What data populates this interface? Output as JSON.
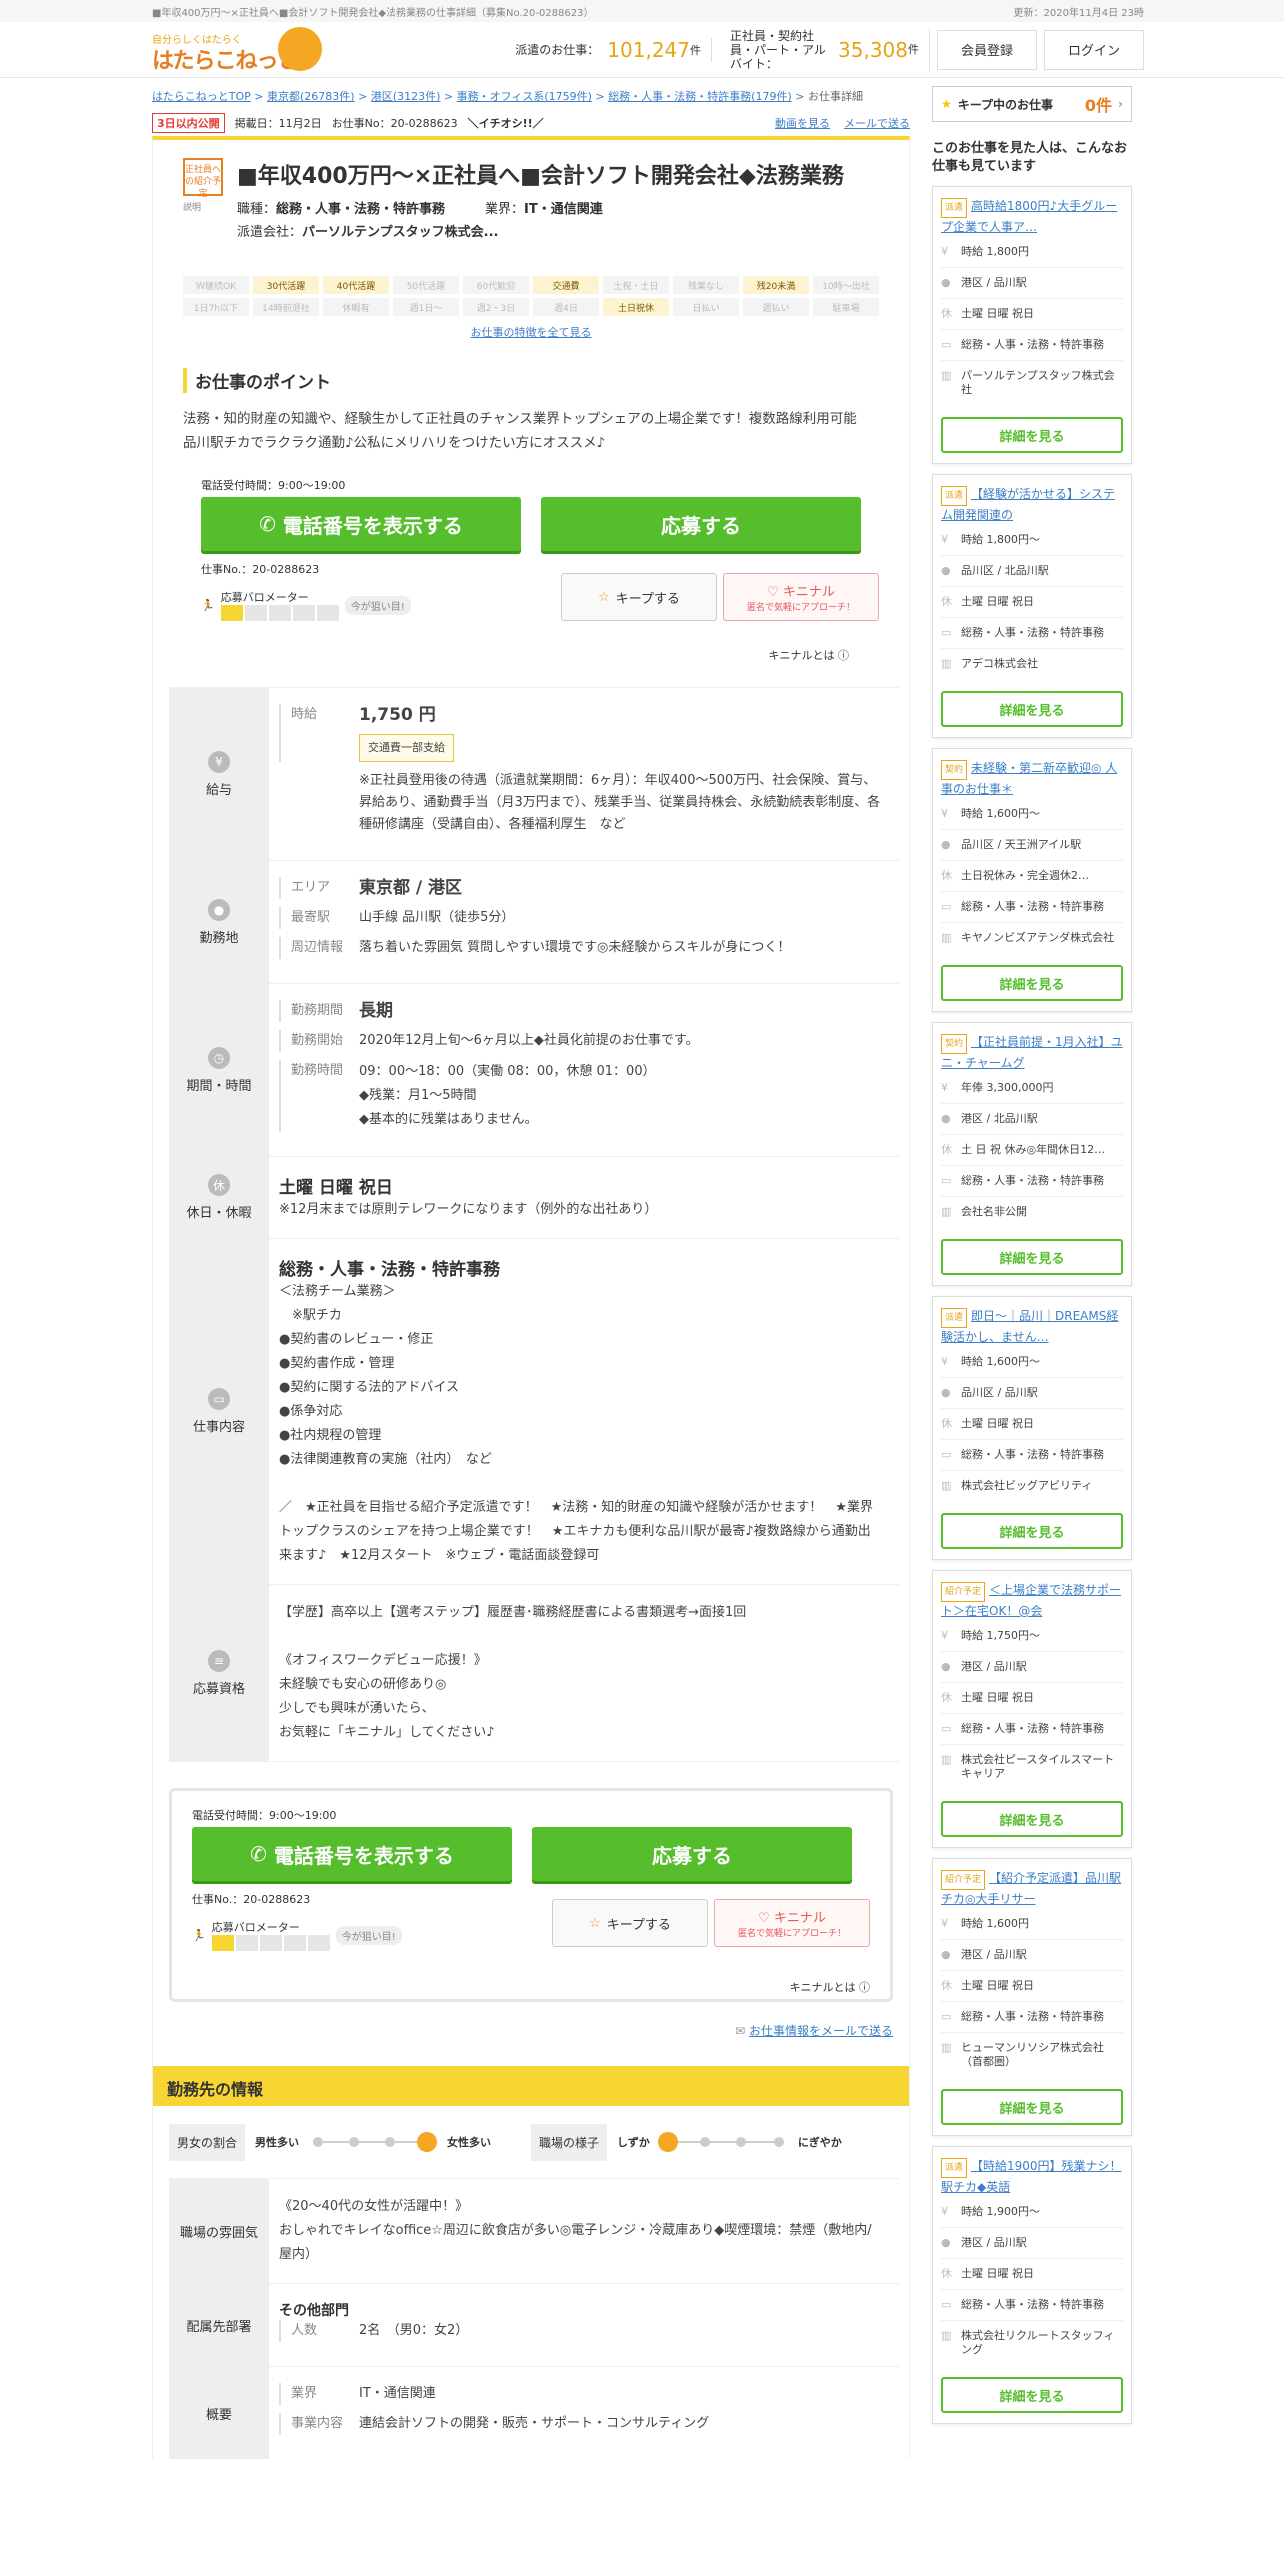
{
  "top": {
    "crumbtext": "■年収400万円～×正社員へ■会計ソフト開発会社◆法務業務の仕事詳細（募集No.20-0288623）",
    "updated": "更新：2020年11月4日 23時"
  },
  "header": {
    "logo_small": "自分らしくはたらく",
    "logo_big": "はたらこねっと",
    "stat1_label": "派遣のお仕事：",
    "stat1_value": "101,247",
    "stat1_unit": "件",
    "stat2_label": "正社員・契約社員・パート・アルバイト：",
    "stat2_value": "35,308",
    "stat2_unit": "件",
    "register": "会員登録",
    "login": "ログイン"
  },
  "breadcrumb": [
    "はたらこねっとTOP",
    "東京都(26783件)",
    "港区(3123件)",
    "事務・オフィス系(1759件)",
    "総務・人事・法務・特許事務(179件)",
    "お仕事詳細"
  ],
  "meta": {
    "new_badge": "3日以内公開",
    "posted": "掲載日：11月2日",
    "job_no": "お仕事No：20-0288623",
    "pick": "＼イチオシ!!／",
    "video": "動画を見る",
    "mail": "メールで送る"
  },
  "job": {
    "tag": "正社員への紹介予定",
    "tag_help": "説明",
    "title": "■年収400万円～×正社員へ■会計ソフト開発会社◆法務業務",
    "category_label": "職種：",
    "category": "総務・人事・法務・特許事務",
    "industry_label": "業界：",
    "industry": "IT・通信関連",
    "agency_label": "派遣会社：",
    "agency": "パーソルテンプスタッフ株式会..."
  },
  "chips": [
    "Ｗ継続OK",
    "30代活躍",
    "40代活躍",
    "50代活躍",
    "60代歓迎",
    "交通費",
    "土祝・土日",
    "残業なし",
    "残20未満",
    "10時～出社",
    "1日7h以下",
    "14時前退社",
    "休暇有",
    "週1日～",
    "週2・3日",
    "週4日",
    "土日祝休",
    "日払い",
    "週払い",
    "駐車場"
  ],
  "chips_on": [
    false,
    true,
    true,
    false,
    false,
    true,
    false,
    false,
    true,
    false,
    false,
    false,
    false,
    false,
    false,
    false,
    true,
    false,
    false,
    false
  ],
  "chips_more": "お仕事の特徴を全て見る",
  "point": {
    "heading": "お仕事のポイント",
    "text": "法務・知的財産の知識や、経験生かして正社員のチャンス業界トップシェアの上場企業です！複数路線利用可能　品川駅チカでラクラク通勤♪公私にメリハリをつけたい方にオススメ♪"
  },
  "cta": {
    "tel_hours": "電話受付時間：9:00～19:00",
    "tel_button": "電話番号を表示する",
    "apply": "応募する",
    "job_no": "仕事No.：20-0288623",
    "barometer": "応募バロメーター",
    "hint": "今が狙い目!",
    "keep": "キープする",
    "kininal": "キニナル",
    "kininal_sub": "匿名で気軽にアプローチ！",
    "kininal_help": "キニナルとは"
  },
  "salary": {
    "label": "給与",
    "k": "時給",
    "v": "1,750 円",
    "badge": "交通費一部支給",
    "note": "※正社員登用後の待遇（派遣就業期間：6ヶ月）：年収400～500万円、社会保険、賞与、昇給あり、通勤費手当（月3万円まで）、残業手当、従業員持株会、永続勤続表彰制度、各種研修講座（受講自由）、各種福利厚生　など"
  },
  "location": {
    "label": "勤務地",
    "area_k": "エリア",
    "area": "東京都 / 港区",
    "station_k": "最寄駅",
    "station": "山手線 品川駅（徒歩5分）",
    "env_k": "周辺情報",
    "env": "落ち着いた雰囲気 質問しやすい環境です◎未経験からスキルが身につく！"
  },
  "period": {
    "label": "期間・時間",
    "term_k": "勤務期間",
    "term": "長期",
    "start_k": "勤務開始",
    "start": "2020年12月上旬～6ヶ月以上◆社員化前提のお仕事です。",
    "time_k": "勤務時間",
    "time": "09：00～18：00（実働 08：00，休憩 01：00）\n◆残業：月1～5時間\n◆基本的に残業はありません。"
  },
  "holiday": {
    "label": "休日・休暇",
    "main": "土曜 日曜 祝日",
    "note": "※12月末までは原則テレワークになります（例外的な出社あり）"
  },
  "work": {
    "label": "仕事内容",
    "title": "総務・人事・法務・特許事務",
    "text": "＜法務チーム業務＞\n　※駅チカ\n●契約書のレビュー・修正\n●契約書作成・管理\n●契約に関する法的アドバイス\n●係争対応\n●社内規程の管理\n●法律関連教育の実施（社内）　など\n\n／　★正社員を目指せる紹介予定派遣です！　★法務・知的財産の知識や経験が活かせます！　★業界トップクラスのシェアを持つ上場企業です！　★エキナカも便利な品川駅が最寄♪複数路線から通勤出来ます♪　★12月スタート　※ウェブ・電話面談登録可"
  },
  "qual": {
    "label": "応募資格",
    "text": "【学歴】高卒以上【選考ステップ】履歴書･職務経歴書による書類選考→面接1回\n\n《オフィスワークデビュー応援！》\n未経験でも安心の研修あり◎\n少しでも興味が湧いたら、\nお気軽に「キニナル」してください♪"
  },
  "mailsend": "お仕事情報をメールで送る",
  "workplace": {
    "heading": "勤務先の情報",
    "ratio_label": "男女の割合",
    "male": "男性多い",
    "female": "女性多い",
    "mood_label": "職場の様子",
    "quiet": "しずか",
    "lively": "にぎやか",
    "atmos_label": "職場の雰囲気",
    "atmos": "《20～40代の女性が活躍中！》\nおしゃれでキレイなoffice☆周辺に飲食店が多い◎電子レンジ・冷蔵庫あり◆喫煙環境：禁煙（敷地内/屋内）",
    "dept_label": "配属先部署",
    "dept": "その他部門",
    "people_k": "人数",
    "people": "2名　（男0：女2）",
    "summary_label": "概要",
    "ind_k": "業界",
    "ind": "IT・通信関連",
    "biz_k": "事業内容",
    "biz": "連結会計ソフトの開発・販売・サポート・コンサルティング"
  },
  "side": {
    "keep_label": "キープ中のお仕事",
    "keep_count": "0件",
    "heading": "このお仕事を見た人は、こんなお仕事も見ています",
    "detail": "詳細を見る",
    "cards": [
      {
        "tag": "派遣",
        "title": "高時給1800円♪大手グループ企業で人事ア…",
        "pay": "時給 1,800円",
        "place": "港区 / 品川駅",
        "days": "土曜 日曜 祝日",
        "cat": "総務・人事・法務・特許事務",
        "co": "パーソルテンプスタッフ株式会社"
      },
      {
        "tag": "派遣",
        "title": "【経験が活かせる】システム開発関連の",
        "pay": "時給 1,800円～",
        "place": "品川区 / 北品川駅",
        "days": "土曜 日曜 祝日",
        "cat": "総務・人事・法務・特許事務",
        "co": "アデコ株式会社"
      },
      {
        "tag": "契約",
        "title": "未経験・第二新卒歓迎◎ 人事のお仕事＊",
        "pay": "時給 1,600円～",
        "place": "品川区 / 天王洲アイル駅",
        "days": "土日祝休み・完全週休2…",
        "cat": "総務・人事・法務・特許事務",
        "co": "キヤノンビズアテンダ株式会社"
      },
      {
        "tag": "契約",
        "title": "【正社員前提・1月入社】ユニ・チャームグ",
        "pay": "年俸 3,300,000円",
        "place": "港区 / 北品川駅",
        "days": "土 日 祝 休み◎年間休日12…",
        "cat": "総務・人事・法務・特許事務",
        "co": "会社名非公開"
      },
      {
        "tag": "派遣",
        "title": "即日～｜品川｜DREAMS経験活かし、ません…",
        "pay": "時給 1,600円～",
        "place": "品川区 / 品川駅",
        "days": "土曜 日曜 祝日",
        "cat": "総務・人事・法務・特許事務",
        "co": "株式会社ビッグアビリティ"
      },
      {
        "tag": "紹介予定",
        "title": "＜上場企業で法務サポート＞在宅OK！@会",
        "pay": "時給 1,750円～",
        "place": "港区 / 品川駅",
        "days": "土曜 日曜 祝日",
        "cat": "総務・人事・法務・特許事務",
        "co": "株式会社ピースタイルスマートキャリア"
      },
      {
        "tag": "紹介予定",
        "title": "【紹介予定派遣】品川駅チカ◎大手リサー",
        "pay": "時給 1,600円",
        "place": "港区 / 品川駅",
        "days": "土曜 日曜 祝日",
        "cat": "総務・人事・法務・特許事務",
        "co": "ヒューマンリソシア株式会社（首都圏）"
      },
      {
        "tag": "派遣",
        "title": "【時給1900円】残業ナシ！駅チカ◆英語",
        "pay": "時給 1,900円～",
        "place": "港区 / 品川駅",
        "days": "土曜 日曜 祝日",
        "cat": "総務・人事・法務・特許事務",
        "co": "株式会社リクルートスタッフィング"
      }
    ]
  },
  "colors": {
    "accent": "#f7d533",
    "green": "#56bd2c",
    "orange": "#e8a317",
    "link": "#3d7fc6"
  }
}
